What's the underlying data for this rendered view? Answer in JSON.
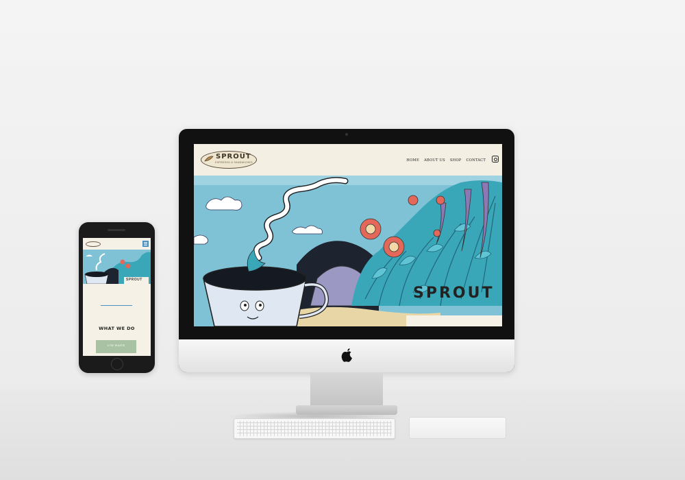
{
  "desktop_site": {
    "logo": {
      "name": "SPROUT",
      "tagline": "ESPRESSO & SANDWICHES"
    },
    "nav": {
      "items": [
        {
          "label": "HOME"
        },
        {
          "label": "ABOUT US"
        },
        {
          "label": "SHOP"
        },
        {
          "label": "CONTACT"
        }
      ],
      "instagram_icon": "instagram-icon"
    },
    "hero": {
      "brand_text": "SPROUT"
    }
  },
  "mobile_site": {
    "logo": {
      "name": "SPROUT"
    },
    "menu_icon": "hamburger-menu-icon",
    "hero_brand": "SPROUT",
    "section_title": "WHAT WE DO",
    "button_label": "LOW WASTE"
  },
  "colors": {
    "page_bg": "#f5f1e6",
    "accent_blue": "#4a8fc2",
    "button_green": "#a9c2a3",
    "mural_sky": "#7fc2d6",
    "mural_teal": "#3aa7b9",
    "mural_flower": "#e3685a"
  }
}
